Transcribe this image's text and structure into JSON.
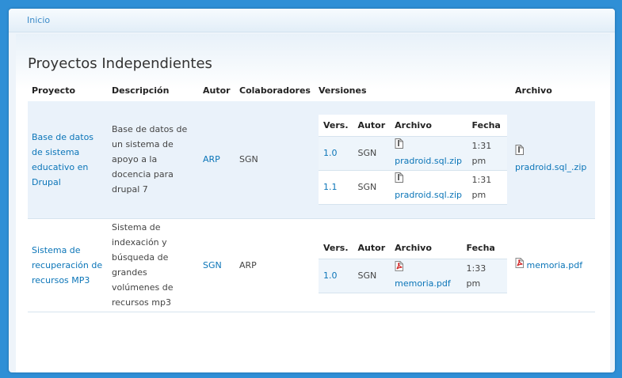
{
  "breadcrumb": {
    "home_label": "Inicio"
  },
  "page_title": "Proyectos Independientes",
  "columns": [
    "Proyecto",
    "Descripción",
    "Autor",
    "Colaboradores",
    "Versiones",
    "Archivo"
  ],
  "version_columns": [
    "Vers.",
    "Autor",
    "Archivo",
    "Fecha"
  ],
  "projects": [
    {
      "name": "Base de datos de sistema educativo en Drupal",
      "description": "Base de datos de un sistema de apoyo a la docencia para drupal 7",
      "author": "ARP",
      "collaborators": "SGN",
      "versions": [
        {
          "version": "1.0",
          "author": "SGN",
          "file": "pradroid.sql.zip",
          "file_icon": "zip-file-icon",
          "date": "1:31 pm"
        },
        {
          "version": "1.1",
          "author": "SGN",
          "file": "pradroid.sql.zip",
          "file_icon": "zip-file-icon",
          "date": "1:31 pm"
        }
      ],
      "file": "pradroid.sql_.zip",
      "file_icon": "zip-file-icon"
    },
    {
      "name": "Sistema de recuperación de recursos MP3",
      "description": "Sistema de indexación y búsqueda de grandes volúmenes de recursos mp3",
      "author": "SGN",
      "collaborators": "ARP",
      "versions": [
        {
          "version": "1.0",
          "author": "SGN",
          "file": "memoria.pdf",
          "file_icon": "pdf-file-icon",
          "date": "1:33 pm"
        }
      ],
      "file": "memoria.pdf",
      "file_icon": "pdf-file-icon"
    }
  ],
  "colors": {
    "link": "#0b75b8",
    "outer_background": "#2f8fd6",
    "row_alt": "#eaf2fa"
  }
}
